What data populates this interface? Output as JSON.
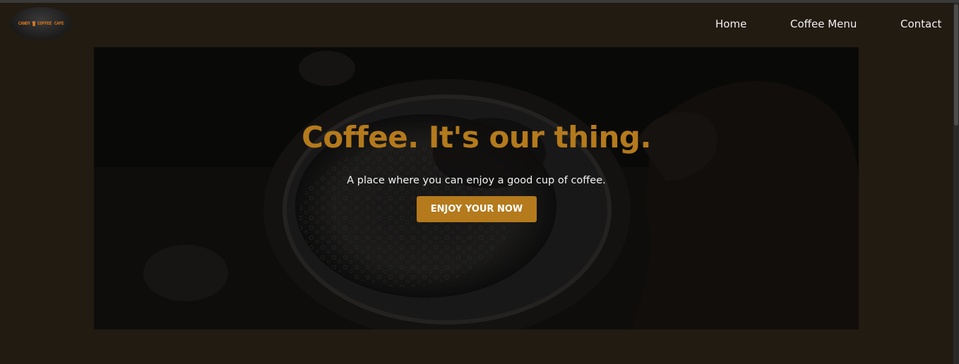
{
  "brand": {
    "logo_left": "CANDY",
    "logo_right": "COFFEE CAFE",
    "logo_icon": "coffee-cup-icon"
  },
  "nav": {
    "items": [
      {
        "label": "Home"
      },
      {
        "label": "Coffee Menu"
      },
      {
        "label": "Contact"
      }
    ]
  },
  "hero": {
    "title": "Coffee. It's our thing.",
    "subtitle": "A place where you can enjoy a good cup of coffee.",
    "cta_label": "ENJOY YOUR NOW",
    "background_image": "dark photo of a hand holding a coffee cup"
  },
  "colors": {
    "page_background": "#221b12",
    "accent": "#b47a1c",
    "nav_text": "#f1f1f1",
    "logo_text": "#e07a1c"
  }
}
